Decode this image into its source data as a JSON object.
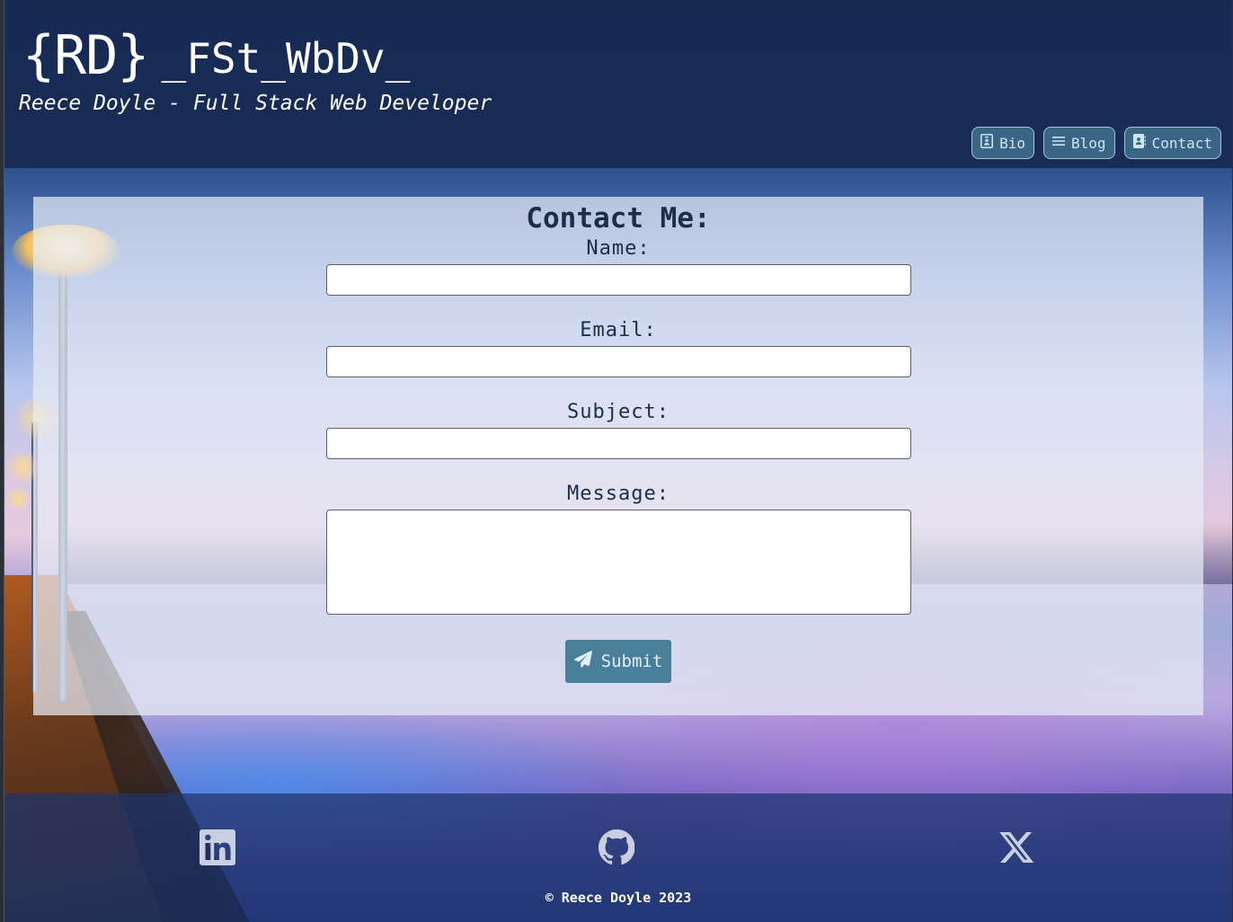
{
  "header": {
    "brand_mark": "{RD}",
    "brand_name": "_FSt_WbDv_",
    "tagline": "Reece Doyle - Full Stack Web Developer"
  },
  "nav": {
    "items": [
      {
        "label": "Bio",
        "icon": "id-badge-icon"
      },
      {
        "label": "Blog",
        "icon": "bars-icon"
      },
      {
        "label": "Contact",
        "icon": "address-book-icon"
      }
    ],
    "active": "Contact"
  },
  "contact_form": {
    "title": "Contact Me:",
    "fields": {
      "name": {
        "label": "Name:",
        "value": ""
      },
      "email": {
        "label": "Email:",
        "value": ""
      },
      "subject": {
        "label": "Subject:",
        "value": ""
      },
      "message": {
        "label": "Message:",
        "value": ""
      }
    },
    "submit_label": "Submit",
    "submit_icon": "paper-plane-icon"
  },
  "footer": {
    "social": [
      {
        "name": "LinkedIn",
        "icon": "linkedin-icon"
      },
      {
        "name": "GitHub",
        "icon": "github-icon"
      },
      {
        "name": "X",
        "icon": "x-twitter-icon"
      }
    ],
    "copyright": "© Reece Doyle 2023"
  },
  "colors": {
    "header_bg": "#182a52",
    "nav_button_bg": "#46789a",
    "nav_button_border": "#9cc3d6",
    "card_text": "#1c2d4a",
    "submit_bg": "#4a7f99",
    "social_icon": "#c8cfe0"
  }
}
